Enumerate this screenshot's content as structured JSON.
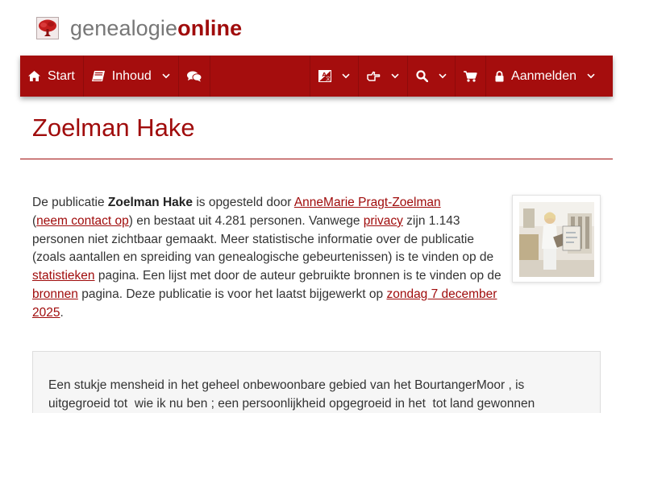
{
  "brand": {
    "name_part1": "genealogie",
    "name_part2": "online",
    "logo_icon": "tree-icon"
  },
  "nav": {
    "start_label": "Start",
    "start_icon": "home-icon",
    "content_label": "Inhoud",
    "content_icon": "book-icon",
    "chat_icon": "comments-icon",
    "language_icon": "language-icon",
    "share_icon": "hand-pointing-icon",
    "search_icon": "search-icon",
    "cart_icon": "shopping-cart-icon",
    "login_label": "Aanmelden",
    "login_icon": "lock-icon"
  },
  "page": {
    "title": "Zoelman Hake"
  },
  "intro": {
    "t1": "De publicatie ",
    "publication_name": "Zoelman Hake",
    "t2": " is opgesteld door ",
    "author_link": "AnneMarie Pragt-Zoelman",
    "t3": "(",
    "contact_link": "neem contact op",
    "t4": ") en bestaat uit 4.281 personen. Vanwege ",
    "privacy_link": "privacy",
    "t5": " zijn 1.143 personen niet zichtbaar gemaakt. Meer statistische informatie over de publicatie (zoals aantallen en spreiding van genealogische gebeurtenissen) is te vinden op de ",
    "stats_link": "statistieken",
    "t6": " pagina. Een lijst met door de auteur gebruikte bronnen is te vinden op de ",
    "sources_link": "bronnen",
    "t7": " pagina. Deze publicatie is voor het laatst bijgewerkt op ",
    "date_link": "zondag 7 december 2025",
    "t8": "."
  },
  "description": {
    "text": "Een stukje mensheid in het geheel onbewoonbare gebied van het BourtangerMoor , is uitgegroeid tot  wie ik nu ben ; een persoonlijkheid opgegroeid in het  tot land gewonnen"
  },
  "colors": {
    "brand_red": "#a50d0d",
    "link_red": "#a00c0c",
    "logo_grey": "#777777"
  }
}
